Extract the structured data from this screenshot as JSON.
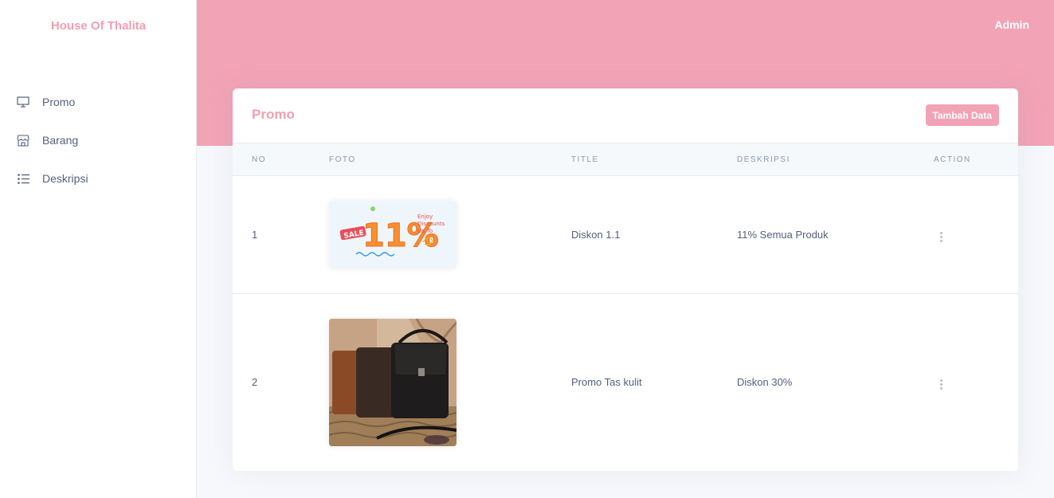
{
  "brand": "House Of Thalita",
  "header": {
    "user": "Admin"
  },
  "sidebar": {
    "items": [
      {
        "label": "Promo",
        "icon": "monitor-icon"
      },
      {
        "label": "Barang",
        "icon": "store-icon"
      },
      {
        "label": "Deskripsi",
        "icon": "list-icon"
      }
    ]
  },
  "card": {
    "title": "Promo",
    "add_button": "Tambah Data",
    "columns": [
      "NO",
      "FOTO",
      "TITLE",
      "DESKRIPSI",
      "ACTION"
    ],
    "rows": [
      {
        "no": "1",
        "title": "Diskon 1.1",
        "desc": "11% Semua Produk",
        "foto": {
          "badge": "SALE",
          "big": "11%",
          "tag1": "Enjoy",
          "tag2": "Discounts",
          "tag3": "Up To"
        }
      },
      {
        "no": "2",
        "title": "Promo Tas kulit",
        "desc": "Diskon 30%",
        "foto": {
          "kind": "leather-bag-photo"
        }
      }
    ]
  },
  "colors": {
    "accent": "#f2a3b5",
    "brand_text": "#f29eb0"
  }
}
